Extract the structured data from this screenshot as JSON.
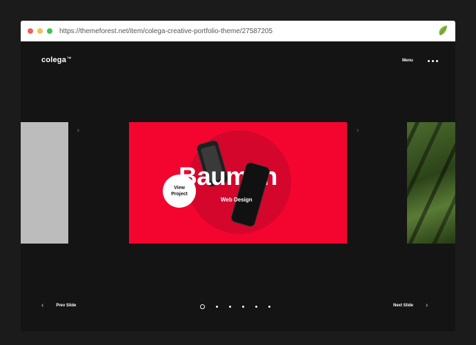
{
  "browser": {
    "url": "https://themeforest.net/item/colega-creative-portfolio-theme/27587205"
  },
  "header": {
    "logo": "colega",
    "logo_tm": "TM",
    "menu_label": "Menu"
  },
  "slides": {
    "left_number": "8",
    "right_number": "3",
    "main": {
      "title": "Bauman",
      "subtitle": "Web Design",
      "cta": "View Project"
    }
  },
  "nav": {
    "prev_label": "Prev Slide",
    "next_label": "Next Slide",
    "prev_icon": "chevron-left-icon",
    "next_icon": "chevron-right-icon"
  },
  "pagination": {
    "count": 6,
    "active": 1
  },
  "colors": {
    "page_bg": "#141414",
    "accent": "#f4052f"
  }
}
